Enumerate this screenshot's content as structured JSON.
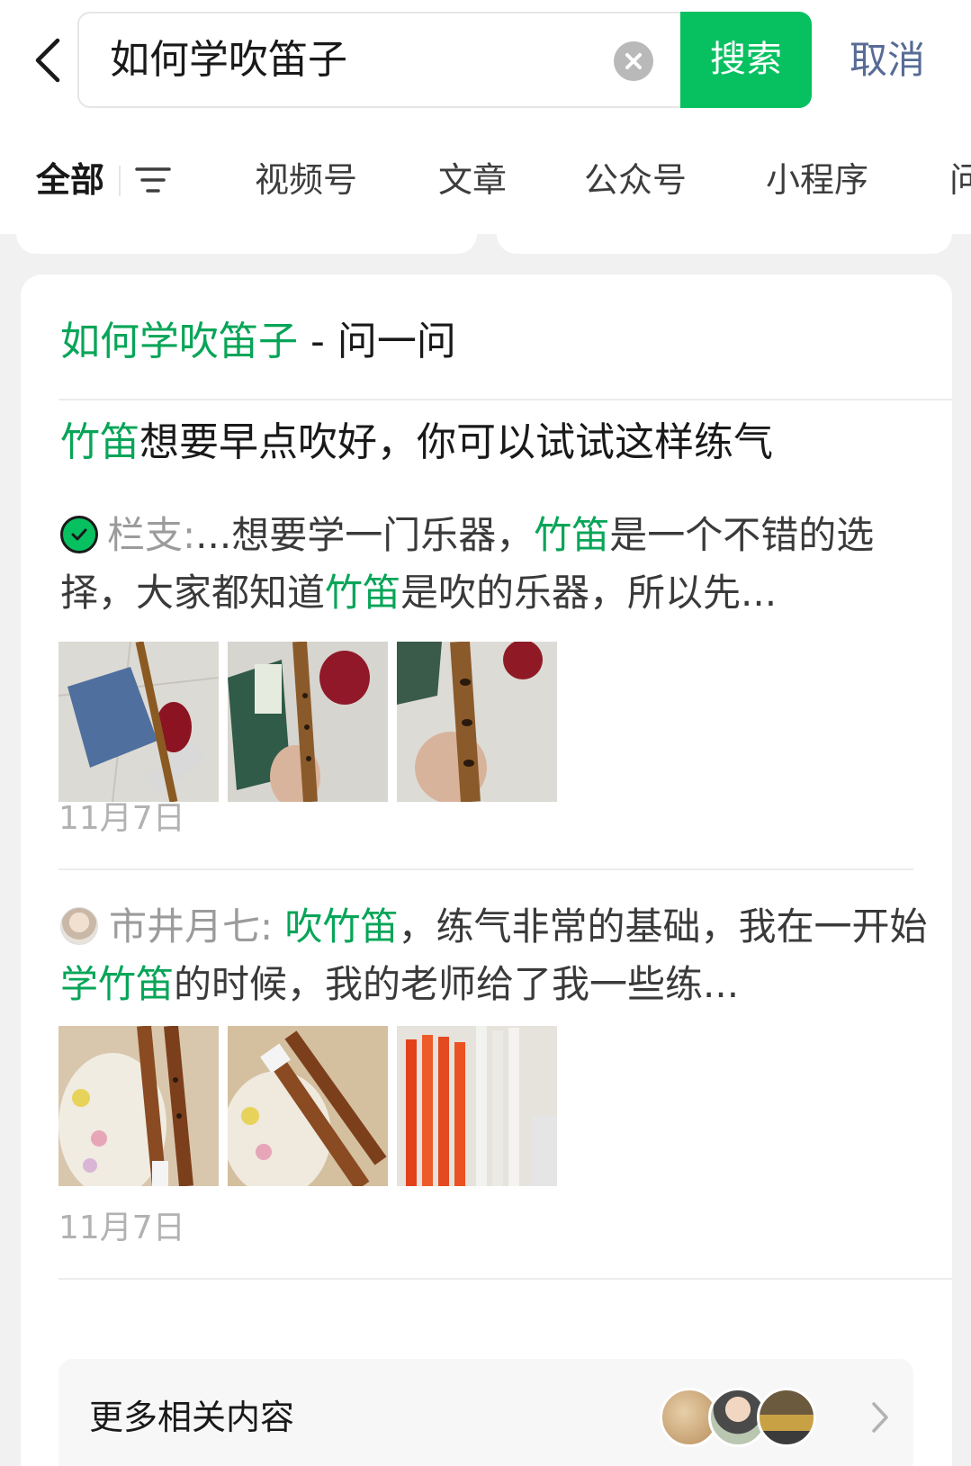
{
  "search": {
    "query": "如何学吹笛子",
    "button_label": "搜索",
    "cancel_label": "取消"
  },
  "tabs": [
    {
      "label": "全部",
      "active": true
    },
    {
      "label": "视频号"
    },
    {
      "label": "文章"
    },
    {
      "label": "公众号"
    },
    {
      "label": "小程序"
    },
    {
      "label": "问"
    }
  ],
  "card": {
    "title_highlight": "如何学吹笛子",
    "title_suffix": " - 问一问",
    "posts": [
      {
        "title_highlight": "竹笛",
        "title_rest": "想要早点吹好，你可以试试这样练气",
        "author": "栏支:",
        "snippet_parts": [
          "...想要学一门乐器，",
          "竹笛",
          "是一个不错的选择，大家都知道",
          "竹笛",
          "是吹的乐器，所以先..."
        ],
        "date": "11月7日"
      },
      {
        "author": "市井月七:",
        "snippet_parts": [
          " ",
          "吹竹笛",
          "，练气非常的基础，我在一开始",
          "学竹笛",
          "的时候，我的老师给了我一些练..."
        ],
        "date": "11月7日"
      }
    ],
    "more_label": "更多相关内容"
  },
  "colors": {
    "accent": "#07c160",
    "highlight_text": "#07a558",
    "cancel_link": "#576b95",
    "background": "#f1f1f1"
  },
  "icons": [
    "back-arrow-icon",
    "clear-icon",
    "filter-icon",
    "verified-icon",
    "chevron-right-icon"
  ]
}
